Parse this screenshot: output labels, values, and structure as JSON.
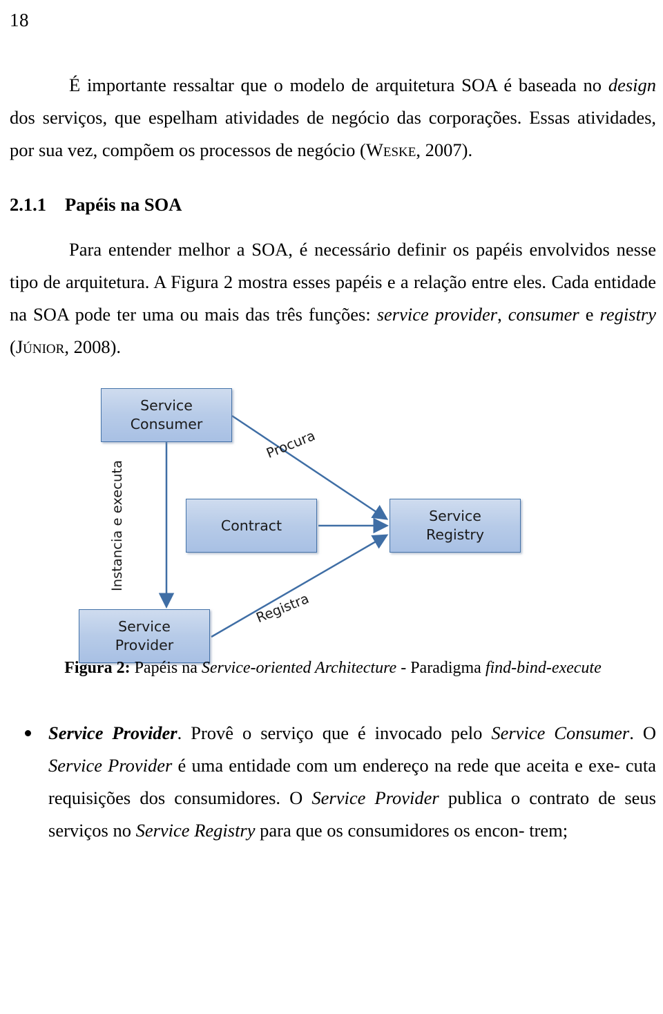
{
  "page": {
    "number": "18"
  },
  "paragraphs": {
    "p1_line1": "É importante ressaltar que o modelo de arquitetura SOA é baseada no",
    "p1_design": "design",
    "p1_line2": " dos serviços, que espelham atividades de negócio das corporações.",
    "p1_essas": "Essas",
    "p1_line3": "atividades, por sua vez, compõem os processos de negócio (",
    "p1_weske": "Weske",
    "p1_line3b": ", 2007)."
  },
  "section": {
    "number": "2.1.1",
    "title": "Papéis na SOA"
  },
  "paragraph2": {
    "line1": "Para entender melhor a SOA, é necessário definir os papéis envolvidos",
    "line2": "nesse tipo de arquitetura.   A Figura 2 mostra esses papéis e a relação entre eles.",
    "line3a": "Cada entidade na SOA pode ter uma ou mais das três funções: ",
    "line3_italic": "service provider",
    "line3b": ",",
    "line4a": "consumer",
    "line4b": " e ",
    "line4c": "registry",
    "line4d": " (",
    "line4_junior": "Júnior",
    "line4e": ", 2008)."
  },
  "diagram": {
    "boxes": {
      "consumer": "Service\nConsumer",
      "consumer_line1": "Service",
      "consumer_line2": "Consumer",
      "contract": "Contract",
      "registry_line1": "Service",
      "registry_line2": "Registry",
      "provider_line1": "Service",
      "provider_line2": "Provider"
    },
    "labels": {
      "instancia": "Instancia e executa",
      "procura": "Procura",
      "registra": "Registra"
    },
    "colors": {
      "box_fill": "#b7cbe8",
      "box_border": "#4472a8",
      "arrow": "#3f6ea5"
    }
  },
  "figure_caption": {
    "label": "Figura 2:",
    "text_a": " Papéis na ",
    "text_b": "Service-oriented Architecture",
    "text_c": " - Paradigma ",
    "text_d": "find-bind-execute"
  },
  "bullets": [
    {
      "lead": "Service Provider",
      "line1a": ". Provê o serviço que é invocado pelo ",
      "line1b": "Service Consumer",
      "line1c": ". O",
      "line2a": "Service Provider",
      "line2b": " é uma entidade com um endereço na rede que aceita e exe-",
      "line3a": "cuta requisições dos consumidores.   O ",
      "line3b": "Service Provider",
      "line3c": " publica o contrato",
      "line4a": "de seus serviços no ",
      "line4b": "Service Registry",
      "line4c": " para que os consumidores os encon-",
      "line5": "trem;"
    }
  ]
}
